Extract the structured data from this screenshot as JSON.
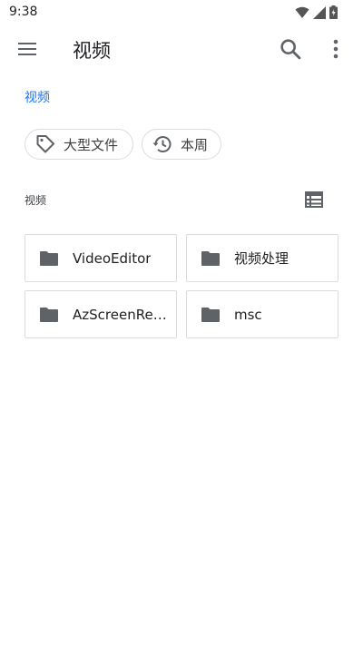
{
  "status_bar": {
    "time": "9:38",
    "icons": [
      "wifi-icon",
      "cell-signal-icon",
      "battery-icon"
    ]
  },
  "app_bar": {
    "title": "视频",
    "icons": [
      "menu-icon",
      "search-icon",
      "more-vert-icon"
    ]
  },
  "breadcrumb": {
    "label": "视频"
  },
  "chips": [
    {
      "label": "大型文件",
      "icon": "tag-icon"
    },
    {
      "label": "本周",
      "icon": "history-icon"
    }
  ],
  "section": {
    "label": "视频",
    "view_toggle_icon": "list-view-icon"
  },
  "folders": [
    {
      "name": "VideoEditor"
    },
    {
      "name": "视频处理"
    },
    {
      "name": "AzScreenRec..."
    },
    {
      "name": "msc"
    }
  ],
  "colors": {
    "accent": "#1a73e8",
    "icon": "#5f6368",
    "border": "#dadce0"
  }
}
